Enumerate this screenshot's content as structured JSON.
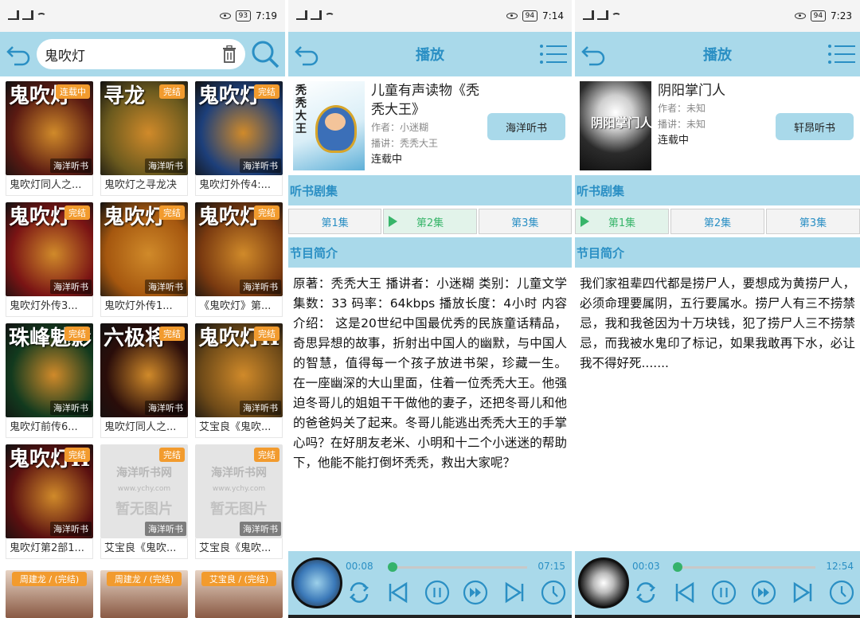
{
  "colors": {
    "header": "#a9d9ea",
    "accent": "#2a8fc4",
    "green": "#35b26b",
    "badge": "#f29b2e"
  },
  "panel1": {
    "status": {
      "left": "HD 5G",
      "battery": "93",
      "time": "7:19"
    },
    "search": {
      "value": "鬼吹灯"
    },
    "icons": [
      "back-arrow-icon",
      "trash-icon",
      "search-icon"
    ],
    "tiles": [
      {
        "title": "鬼吹灯同人之...",
        "badge": "连载中",
        "src": "海洋听书",
        "cover_text": "鬼吹灯",
        "bg": "#5a1a12"
      },
      {
        "title": "鬼吹灯之寻龙决",
        "badge": "完结",
        "src": "海洋听书",
        "cover_text": "寻龙",
        "bg": "#6b5a1e"
      },
      {
        "title": "鬼吹灯外传4:...",
        "badge": "完结",
        "src": "海洋听书",
        "cover_text": "鬼吹灯",
        "bg": "#1d3f7a"
      },
      {
        "title": "鬼吹灯外传3...",
        "badge": "完结",
        "src": "海洋听书",
        "cover_text": "鬼吹灯",
        "bg": "#7a1414"
      },
      {
        "title": "鬼吹灯外传1...",
        "badge": "完结",
        "src": "海洋听书",
        "cover_text": "鬼吹灯",
        "bg": "#a5570f"
      },
      {
        "title": "《鬼吹灯》第...",
        "badge": "完结",
        "src": "海洋听书",
        "cover_text": "鬼吹灯",
        "bg": "#7a3a10"
      },
      {
        "title": "鬼吹灯前传6...",
        "badge": "完结",
        "src": "海洋听书",
        "cover_text": "珠峰魅影",
        "bg": "#123a1e"
      },
      {
        "title": "鬼吹灯同人之...",
        "badge": "完结",
        "src": "海洋听书",
        "cover_text": "六极将",
        "bg": "#2a0d0a"
      },
      {
        "title": "艾宝良《鬼吹...",
        "badge": "完结",
        "src": "海洋听书",
        "cover_text": "鬼吹灯II",
        "bg": "#6e4a18"
      },
      {
        "title": "鬼吹灯第2部1...",
        "badge": "完结",
        "src": "海洋听书",
        "cover_text": "鬼吹灯II",
        "bg": "#5a1010"
      },
      {
        "title": "艾宝良《鬼吹...",
        "badge": "完结",
        "src": "海洋听书",
        "noimg": true
      },
      {
        "title": "艾宝良《鬼吹...",
        "badge": "完结",
        "src": "海洋听书",
        "noimg": true
      }
    ],
    "noimg_brand": "海洋听书网",
    "noimg_url": "www.ychy.com",
    "noimg_text": "暂无图片",
    "partial": [
      "周建龙 / (完结)",
      "周建龙 / (完结)",
      "艾宝良 / (完结)"
    ]
  },
  "panel2": {
    "status": {
      "left": "HD 5G",
      "battery": "94",
      "time": "7:14"
    },
    "header_title": "播放",
    "book": {
      "cover_text": "秃秃大王",
      "title": "儿童有声读物《秃秃大王》",
      "author_label": "作者：",
      "author": "小迷糊",
      "narrator_label": "播讲：",
      "narrator": "秃秃大王",
      "status": "连载中",
      "source": "海洋听书"
    },
    "episodes_title": "听书剧集",
    "episodes": [
      "第1集",
      "第2集",
      "第3集"
    ],
    "active_episode": 1,
    "intro_title": "节目简介",
    "intro": "原著：秃秃大王 播讲者：小迷糊 类别：儿童文学 集数：33 码率：64kbps 播放长度：4小时 内容介绍： 这是20世纪中国最优秀的民族童话精品，奇思异想的故事，折射出中国人的幽默，与中国人的智慧，值得每一个孩子放进书架，珍藏一生。 在一座幽深的大山里面，住着一位秃秃大王。他强迫冬哥儿的姐姐干干做他的妻子，还把冬哥儿和他的爸爸妈关了起来。冬哥儿能逃出秃秃大王的手掌心吗？在好朋友老米、小明和十二个小迷迷的帮助下，他能不能打倒坏秃秃，救出大家呢？",
    "player": {
      "current": "00:08",
      "total": "07:15",
      "progress": 0.0184
    }
  },
  "panel3": {
    "status": {
      "left": "HD 5G",
      "battery": "94",
      "time": "7:23"
    },
    "header_title": "播放",
    "book": {
      "cover_text": "阴阳掌门人",
      "title": "阴阳掌门人",
      "author_label": "作者：",
      "author": "未知",
      "narrator_label": "播讲：",
      "narrator": "未知",
      "status": "连载中",
      "source": "轩昂听书"
    },
    "episodes_title": "听书剧集",
    "episodes": [
      "第1集",
      "第2集",
      "第3集"
    ],
    "active_episode": 0,
    "intro_title": "节目简介",
    "intro": "我们家祖辈四代都是捞尸人，要想成为黄捞尸人，必须命理要属阴，五行要属水。捞尸人有三不捞禁忌，我和我爸因为十万块钱，犯了捞尸人三不捞禁忌，而我被水鬼印了标记，如果我敢再下水，必让我不得好死.......",
    "player": {
      "current": "00:03",
      "total": "12:54",
      "progress": 0.0039
    }
  }
}
